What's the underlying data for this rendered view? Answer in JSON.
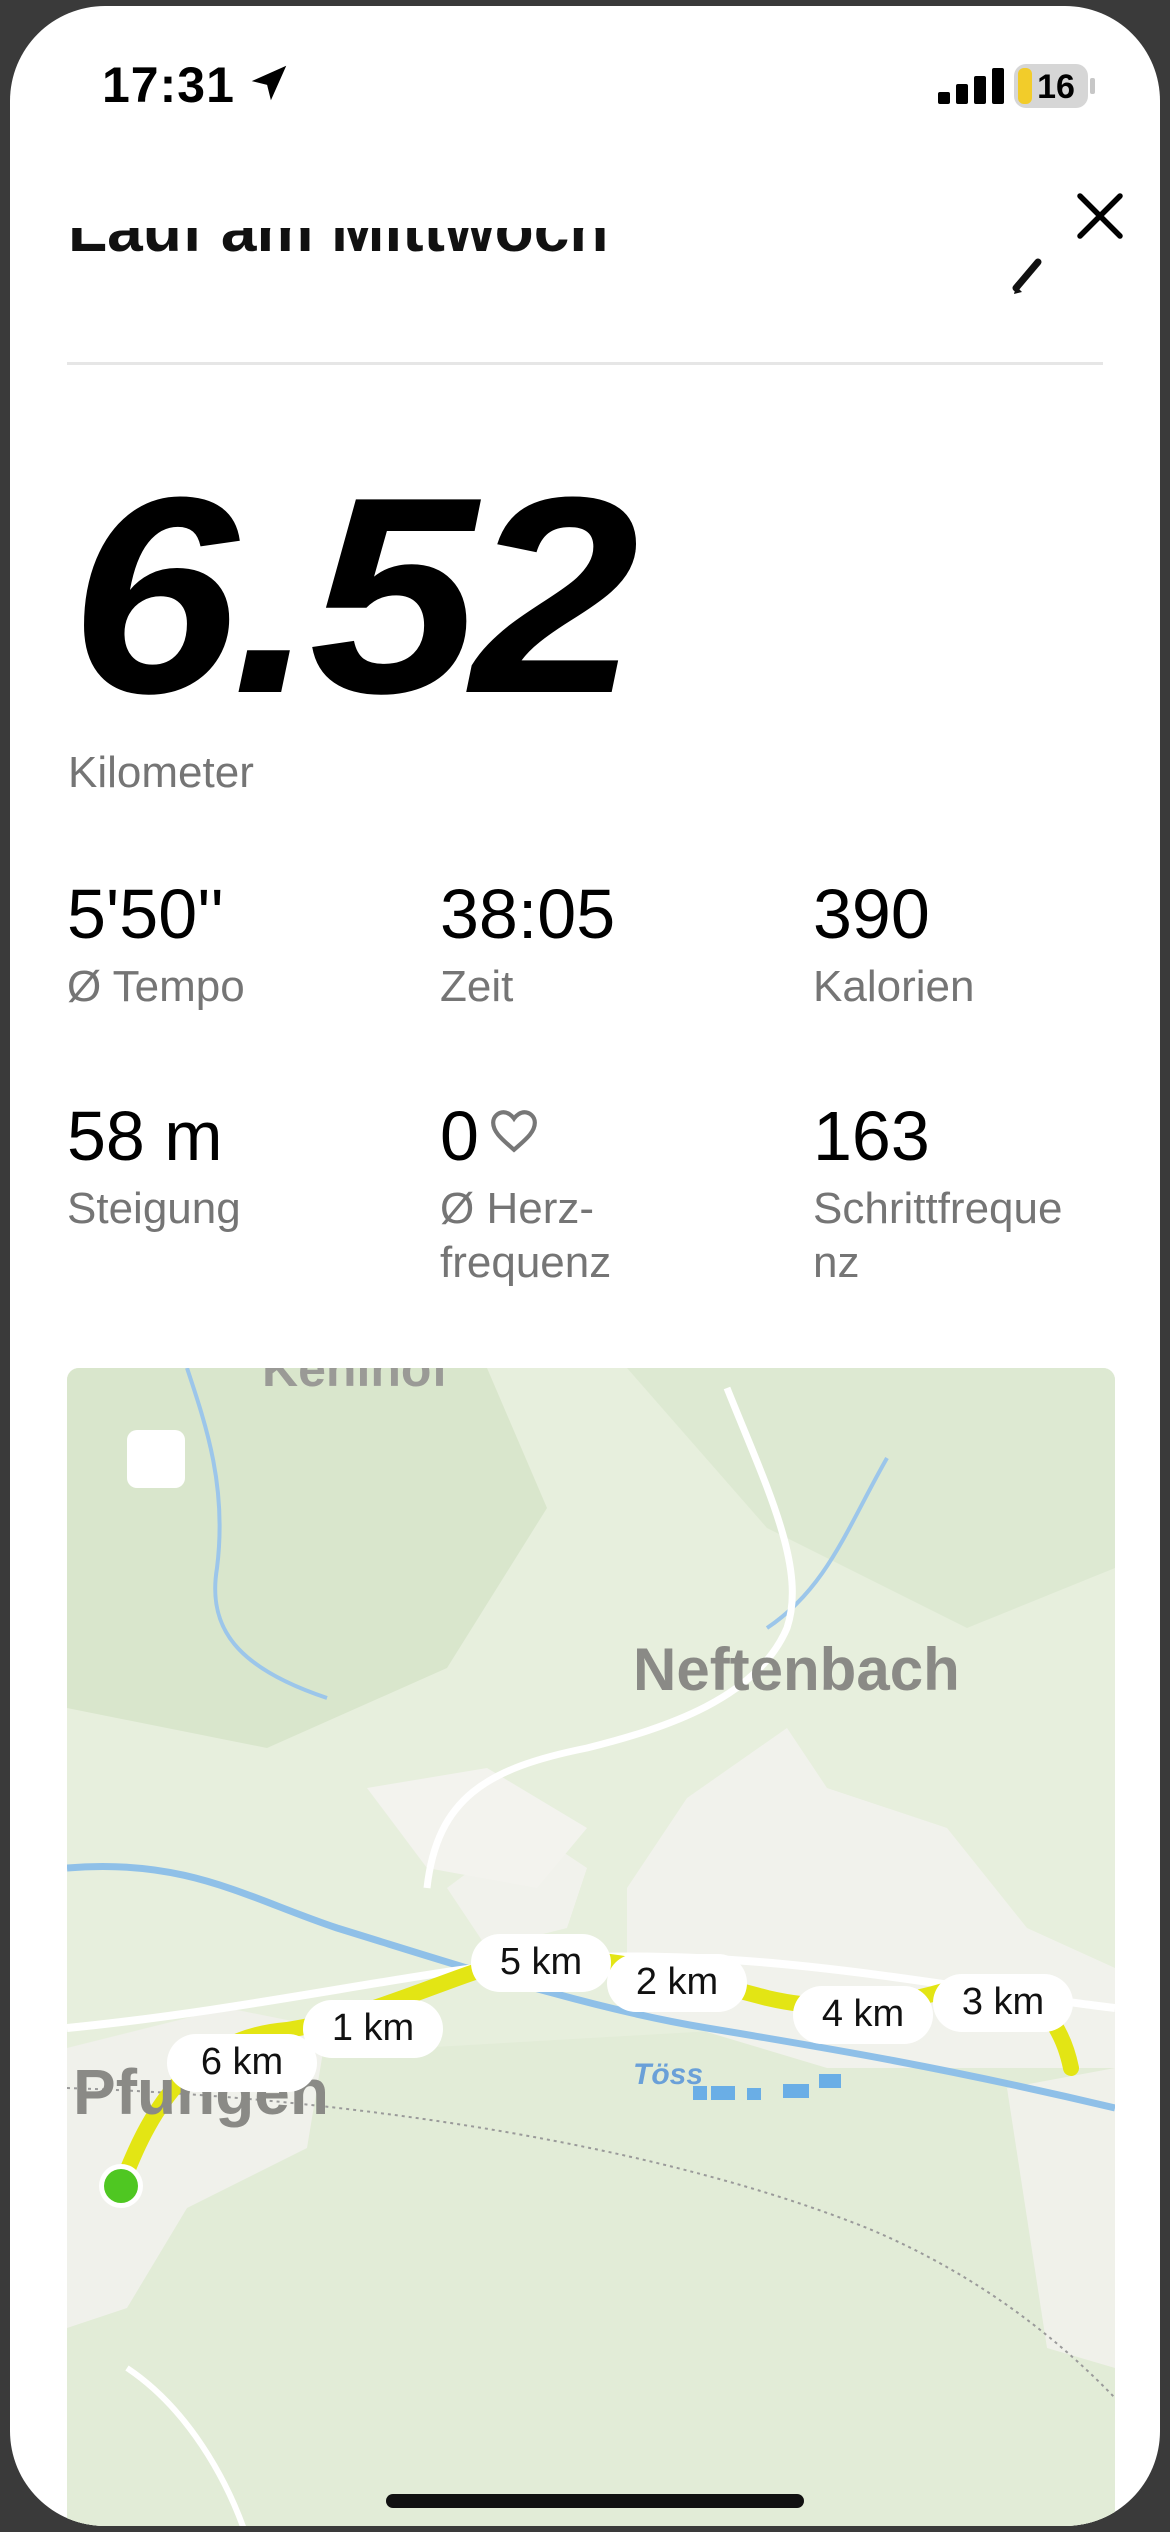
{
  "status_bar": {
    "time": "17:31",
    "battery": "16"
  },
  "header": {
    "title": "Lauf am Mittwoch"
  },
  "summary": {
    "distance_value": "6.52",
    "distance_unit": "Kilometer"
  },
  "stats": [
    {
      "value": "5'50''",
      "label": "Ø Tempo"
    },
    {
      "value": "38:05",
      "label": "Zeit"
    },
    {
      "value": "390",
      "label": "Kalorien"
    },
    {
      "value": "58 m",
      "label": "Steigung"
    },
    {
      "value": "0",
      "label": "Ø Herz-\nfrequenz"
    },
    {
      "value": "163",
      "label": "Schrittfreque\nnz"
    }
  ],
  "map": {
    "places": {
      "north": "Kehlhof",
      "town": "Neftenbach",
      "start_town": "Pfungen",
      "river": "Töss"
    },
    "markers": [
      "1 km",
      "2 km",
      "3 km",
      "4 km",
      "5 km",
      "6 km"
    ],
    "route_color": "#e3e514",
    "start_color": "#4fc722"
  }
}
